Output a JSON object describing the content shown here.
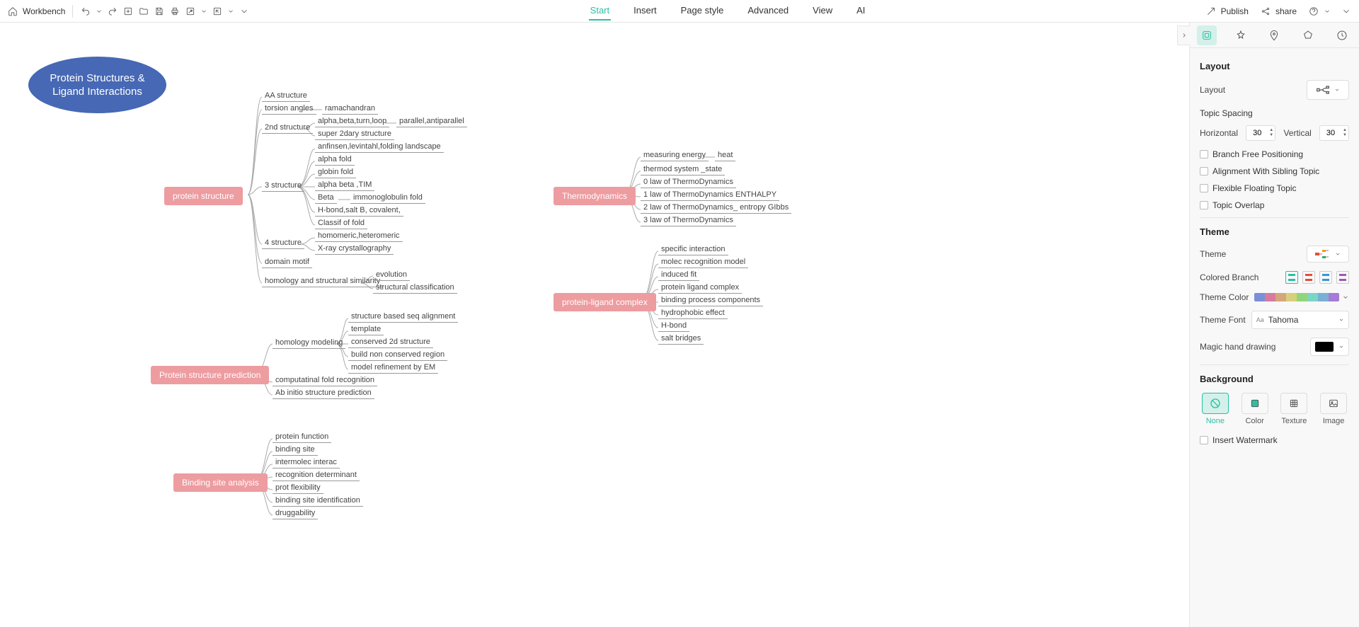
{
  "topbar": {
    "workbench": "Workbench",
    "nav": [
      "Start",
      "Insert",
      "Page style",
      "Advanced",
      "View",
      "AI"
    ],
    "active_nav": 0,
    "publish": "Publish",
    "share": "share"
  },
  "central_title": "Protein Structures & Ligand Interactions",
  "mainnodes": {
    "protein_structure": "protein structure",
    "protein_prediction": "Protein structure prediction",
    "binding_site": "Binding site analysis",
    "thermo": "Thermodynamics",
    "complex": "protein-ligand complex"
  },
  "protein_structure_children": {
    "aa": "AA structure",
    "torsion": "torsion angles",
    "ramachandran": "ramachandran",
    "second": "2nd structure",
    "abtl": "alpha,beta,turn,loop",
    "paranti": "parallel,antiparallel",
    "super2": "super 2dary structure",
    "third": "3 structure",
    "anfinsen": "anfinsen,levintahl,folding landscape",
    "alphafold": "alpha fold",
    "globin": "globin fold",
    "alphabeta": "alpha beta ,TIM",
    "beta": "Beta",
    "immuno": "immonoglobulin fold",
    "hbond": "H-bond,salt B, covalent,",
    "classif": "Classif of fold",
    "fourth": "4 structure",
    "homomeric": "homomeric,heteromeric",
    "xray": "X-ray crystallography",
    "motif": "domain motif",
    "homology": "homology and structural similarity",
    "evolution": "evolution",
    "structclass": "structural classification"
  },
  "prediction_children": {
    "homomodel": "homology modeling",
    "seqalign": "structure based seq alignment",
    "template": "template",
    "cons2d": "conserved 2d structure",
    "buildnon": "build non conserved region",
    "refineEM": "model refinement by EM",
    "compfold": "computatinal fold recognition",
    "abinitio": "Ab initio structure prediction"
  },
  "binding_children": {
    "protfunc": "protein function",
    "bsite": "binding site",
    "intermol": "intermolec interac",
    "recog": "recognition determinant",
    "flex": "prot flexibility",
    "bsid": "binding site identification",
    "drug": "druggability"
  },
  "thermo_children": {
    "measure": "measuring energy",
    "heat": "heat",
    "system": "thermod system _state",
    "law0": "0 law of ThermoDynamics",
    "law1": "1 law of ThermoDynamics ENTHALPY",
    "law2": "2 law of ThermoDynamics_ entropy GIbbs",
    "law3": "3 law of ThermoDynamics"
  },
  "complex_children": {
    "specific": "specific interaction",
    "molecrec": "molec recognition model",
    "induced": "induced fit",
    "pligand": "protein ligand complex",
    "bindcomp": "binding process components",
    "hydrophob": "hydrophobic effect",
    "hbond2": "H-bond",
    "salt": "salt bridges"
  },
  "panel": {
    "layout_title": "Layout",
    "layout_label": "Layout",
    "topic_spacing": "Topic Spacing",
    "horizontal": "Horizontal",
    "vertical": "Vertical",
    "h_val": "30",
    "v_val": "30",
    "branch_free": "Branch Free Positioning",
    "align_sibling": "Alignment With Sibling Topic",
    "flex_float": "Flexible Floating Topic",
    "overlap": "Topic Overlap",
    "theme_title": "Theme",
    "theme_label": "Theme",
    "colored_branch": "Colored Branch",
    "theme_color": "Theme Color",
    "theme_font": "Theme Font",
    "font_value": "Tahoma",
    "magic_hand": "Magic hand drawing",
    "background_title": "Background",
    "bg_none": "None",
    "bg_color": "Color",
    "bg_texture": "Texture",
    "bg_image": "Image",
    "watermark": "Insert Watermark"
  },
  "chart_data": {
    "type": "mindmap",
    "title": "Protein Structures & Ligand Interactions",
    "root": {
      "label": "Protein Structures & Ligand Interactions",
      "children": [
        {
          "label": "protein structure",
          "children": [
            {
              "label": "AA structure"
            },
            {
              "label": "torsion angles",
              "children": [
                {
                  "label": "ramachandran"
                }
              ]
            },
            {
              "label": "2nd structure",
              "children": [
                {
                  "label": "alpha,beta,turn,loop",
                  "children": [
                    {
                      "label": "parallel,antiparallel"
                    }
                  ]
                },
                {
                  "label": "super 2dary structure"
                }
              ]
            },
            {
              "label": "3 structure",
              "children": [
                {
                  "label": "anfinsen,levintahl,folding landscape"
                },
                {
                  "label": "alpha fold"
                },
                {
                  "label": "globin fold"
                },
                {
                  "label": "alpha beta ,TIM"
                },
                {
                  "label": "Beta",
                  "children": [
                    {
                      "label": "immonoglobulin fold"
                    }
                  ]
                },
                {
                  "label": "H-bond,salt B, covalent,"
                },
                {
                  "label": "Classif of fold"
                }
              ]
            },
            {
              "label": "4 structure",
              "children": [
                {
                  "label": "homomeric,heteromeric"
                },
                {
                  "label": "X-ray crystallography"
                }
              ]
            },
            {
              "label": "domain motif"
            },
            {
              "label": "homology and structural similarity",
              "children": [
                {
                  "label": "evolution"
                },
                {
                  "label": "structural classification"
                }
              ]
            }
          ]
        },
        {
          "label": "Protein structure prediction",
          "children": [
            {
              "label": "homology modeling",
              "children": [
                {
                  "label": "structure based seq alignment"
                },
                {
                  "label": "template"
                },
                {
                  "label": "conserved 2d structure"
                },
                {
                  "label": "build non conserved region"
                },
                {
                  "label": "model refinement by EM"
                }
              ]
            },
            {
              "label": "computatinal fold recognition"
            },
            {
              "label": "Ab initio structure prediction"
            }
          ]
        },
        {
          "label": "Binding site analysis",
          "children": [
            {
              "label": "protein function"
            },
            {
              "label": "binding site"
            },
            {
              "label": "intermolec interac"
            },
            {
              "label": "recognition determinant"
            },
            {
              "label": "prot flexibility"
            },
            {
              "label": "binding site identification"
            },
            {
              "label": "druggability"
            }
          ]
        },
        {
          "label": "Thermodynamics",
          "children": [
            {
              "label": "measuring energy",
              "children": [
                {
                  "label": "heat"
                }
              ]
            },
            {
              "label": "thermod system _state"
            },
            {
              "label": "0 law of ThermoDynamics"
            },
            {
              "label": "1 law of ThermoDynamics ENTHALPY"
            },
            {
              "label": "2 law of ThermoDynamics_ entropy GIbbs"
            },
            {
              "label": "3 law of ThermoDynamics"
            }
          ]
        },
        {
          "label": "protein-ligand complex",
          "children": [
            {
              "label": "specific interaction"
            },
            {
              "label": "molec recognition model"
            },
            {
              "label": "induced fit"
            },
            {
              "label": "protein ligand complex"
            },
            {
              "label": "binding process components"
            },
            {
              "label": "hydrophobic effect"
            },
            {
              "label": "H-bond"
            },
            {
              "label": "salt bridges"
            }
          ]
        }
      ]
    }
  }
}
